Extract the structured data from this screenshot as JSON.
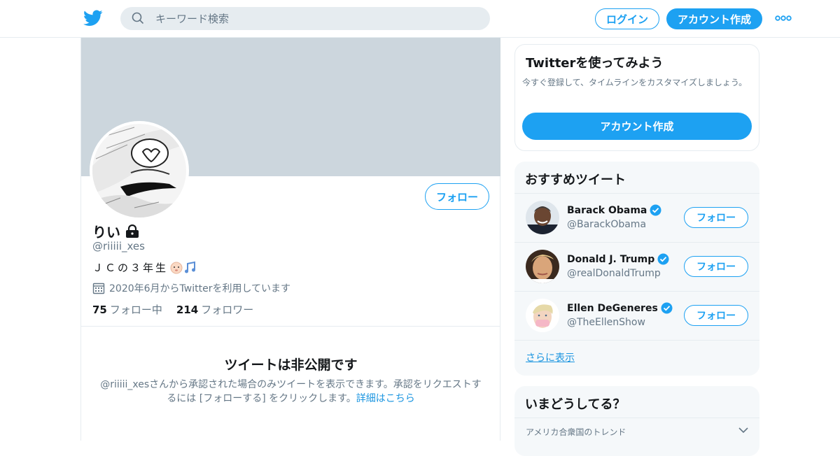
{
  "header": {
    "logo_icon": "twitter-bird-icon",
    "search_placeholder": "キーワード検索",
    "login_label": "ログイン",
    "signup_label": "アカウント作成",
    "more_icon": "more-dots-icon"
  },
  "profile": {
    "name": "りい",
    "protected_icon": "lock-icon",
    "handle": "@riiiii_xes",
    "bio": "ＪＣの３年生",
    "bio_emoji": [
      "baby-face-emoji",
      "music-notes-emoji"
    ],
    "joined": "2020年6月からTwitterを利用しています",
    "following_count": "75",
    "following_label": "フォロー中",
    "followers_count": "214",
    "followers_label": "フォロワー",
    "follow_label": "フォロー"
  },
  "private_notice": {
    "title": "ツイートは非公開です",
    "description": "@riiiii_xesさんから承認された場合のみツイートを表示できます。承認をリクエストするには [フォローする] をクリックします。",
    "link": "詳細はこちら"
  },
  "signup_card": {
    "title": "Twitterを使ってみよう",
    "description": "今すぐ登録して、タイムラインをカスタマイズしましょう。",
    "button": "アカウント作成"
  },
  "recommended": {
    "title": "おすすめツイート",
    "items": [
      {
        "name": "Barack Obama",
        "handle": "@BarackObama",
        "button": "フォロー"
      },
      {
        "name": "Donald J. Trump",
        "handle": "@realDonaldTrump",
        "button": "フォロー"
      },
      {
        "name": "Ellen DeGeneres",
        "handle": "@TheEllenShow",
        "button": "フォロー"
      }
    ],
    "more": "さらに表示"
  },
  "trends": {
    "title": "いまどうしてる？",
    "location": "アメリカ合衆国のトレンド"
  },
  "colors": {
    "accent": "#1da1f2",
    "banner": "#ccd6dd",
    "panel_bg": "#f5f8fa"
  }
}
